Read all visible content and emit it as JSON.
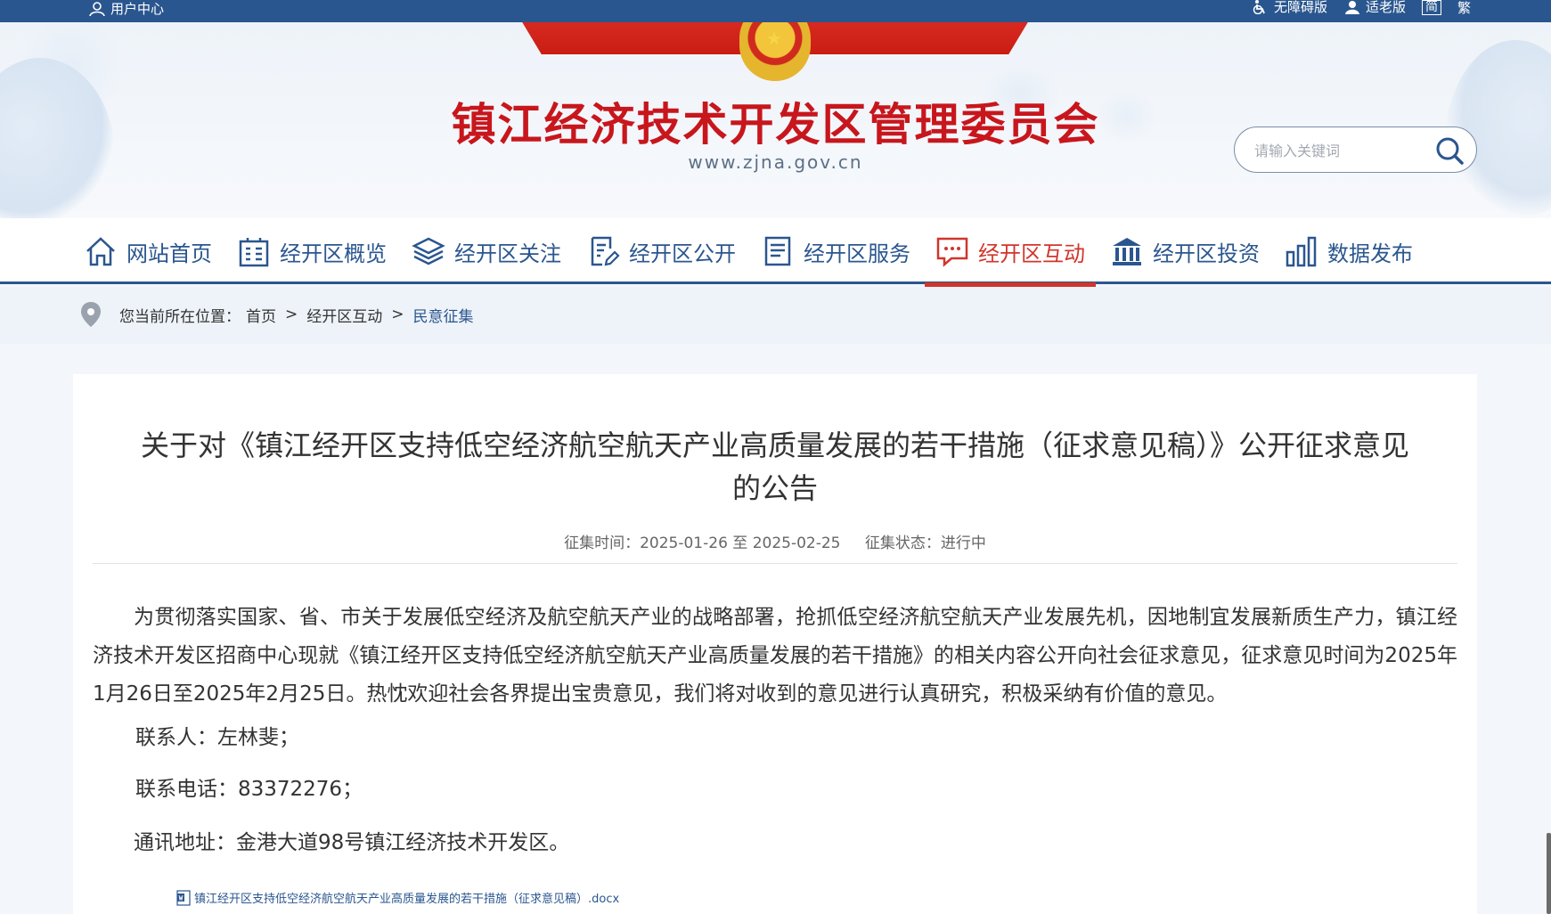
{
  "topbar": {
    "user_center": "用户中心",
    "accessible": "无障碍版",
    "elderly": "适老版",
    "simplified": "简",
    "traditional": "繁"
  },
  "header": {
    "title": "镇江经济技术开发区管理委员会",
    "url": "www.zjna.gov.cn",
    "search_placeholder": "请输入关键词"
  },
  "nav": {
    "items": [
      {
        "label": "网站首页",
        "icon": "home-icon"
      },
      {
        "label": "经开区概览",
        "icon": "building-icon"
      },
      {
        "label": "经开区关注",
        "icon": "layers-icon"
      },
      {
        "label": "经开区公开",
        "icon": "edit-document-icon"
      },
      {
        "label": "经开区服务",
        "icon": "list-document-icon"
      },
      {
        "label": "经开区互动",
        "icon": "chat-icon",
        "active": true
      },
      {
        "label": "经开区投资",
        "icon": "bank-icon"
      },
      {
        "label": "数据发布",
        "icon": "bar-chart-icon"
      }
    ]
  },
  "breadcrumb": {
    "prefix": "您当前所在位置：",
    "home": "首页",
    "section": "经开区互动",
    "current": "民意征集"
  },
  "article": {
    "title_line1": "关于对《镇江经开区支持低空经济航空航天产业高质量发展的若干措施（征求意见稿）》公开征求意见",
    "title_line2": "的公告",
    "time_label": "征集时间：2025-01-26 至 2025-02-25",
    "status_label": "征集状态：进行中",
    "paragraph": "为贯彻落实国家、省、市关于发展低空经济及航空航天产业的战略部署，抢抓低空经济航空航天产业发展先机，因地制宜发展新质生产力，镇江经济技术开发区招商中心现就《镇江经开区支持低空经济航空航天产业高质量发展的若干措施》的相关内容公开向社会征求意见，征求意见时间为2025年1月26日至2025年2月25日。热忱欢迎社会各界提出宝贵意见，我们将对收到的意见进行认真研究，积极采纳有价值的意见。",
    "contact": "联系人：左林斐；",
    "phone": "联系电话：83372276；",
    "address": "通讯地址：金港大道98号镇江经济技术开发区。",
    "attachment": "镇江经开区支持低空经济航空航天产业高质量发展的若干措施（征求意见稿）.docx"
  },
  "colors": {
    "brand_blue": "#2a568f",
    "brand_red": "#c8161d",
    "active_red": "#d1352b"
  }
}
